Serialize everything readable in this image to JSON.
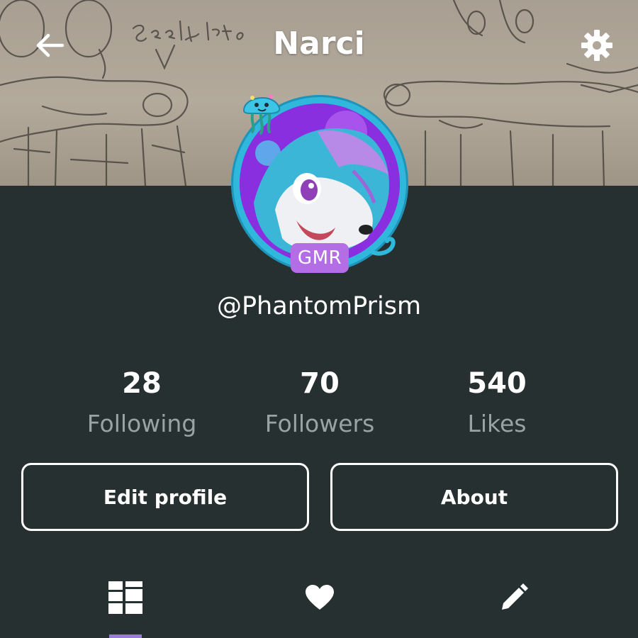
{
  "header": {
    "title": "Narci",
    "back_icon": "arrow-left-icon",
    "settings_icon": "gear-icon"
  },
  "banner": {
    "sketch_text": "seeimit."
  },
  "profile": {
    "badge": "GMR",
    "handle": "@PhantomPrism"
  },
  "stats": [
    {
      "value": "28",
      "label": "Following"
    },
    {
      "value": "70",
      "label": "Followers"
    },
    {
      "value": "540",
      "label": "Likes"
    }
  ],
  "actions": {
    "edit_profile": "Edit profile",
    "about": "About"
  },
  "tabs": [
    {
      "icon": "grid-icon",
      "active": true
    },
    {
      "icon": "heart-icon",
      "active": false
    },
    {
      "icon": "pencil-icon",
      "active": false
    }
  ],
  "colors": {
    "background": "#273030",
    "accent": "#9a7bd9",
    "badge": "#b36ee6",
    "avatar_ring": "#2fb7dc",
    "muted_text": "#9aa3a3"
  }
}
